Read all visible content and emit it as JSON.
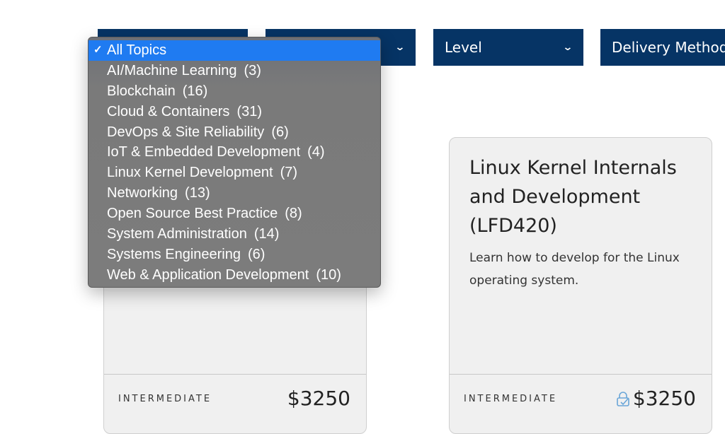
{
  "filters": [
    {
      "label": "",
      "icon": "chevron-down-icon"
    },
    {
      "label": "",
      "icon": "chevron-down-icon"
    },
    {
      "label": "Level",
      "icon": "chevron-down-icon"
    },
    {
      "label": "Delivery Method",
      "icon": "chevron-down-icon"
    }
  ],
  "topic_dropdown": {
    "check_icon": "✓",
    "options": [
      {
        "label": "All Topics",
        "count": "",
        "selected": true
      },
      {
        "label": "AI/Machine Learning",
        "count": "(3)"
      },
      {
        "label": "Blockchain",
        "count": "(16)"
      },
      {
        "label": "Cloud & Containers",
        "count": "(31)"
      },
      {
        "label": "DevOps & Site Reliability",
        "count": "(6)"
      },
      {
        "label": "IoT & Embedded Development",
        "count": "(4)"
      },
      {
        "label": "Linux Kernel Development",
        "count": "(7)"
      },
      {
        "label": "Networking",
        "count": "(13)"
      },
      {
        "label": "Open Source Best Practice",
        "count": "(8)"
      },
      {
        "label": "System Administration",
        "count": "(14)"
      },
      {
        "label": "Systems Engineering",
        "count": "(6)"
      },
      {
        "label": "Web & Application Development",
        "count": "(10)"
      }
    ]
  },
  "courses": [
    {
      "title": "",
      "description": "",
      "level": "INTERMEDIATE",
      "price": "$3250"
    },
    {
      "title": "Linux Kernel Internals and Development (LFD420)",
      "description": "Learn how to develop for the Linux operating system.",
      "level": "INTERMEDIATE",
      "price": "$3250",
      "icon": "lock-check-icon"
    }
  ],
  "colors": {
    "filter_bg": "#063465",
    "selected_option": "#1f7bf1",
    "lock_icon": "#6aa6d8"
  }
}
